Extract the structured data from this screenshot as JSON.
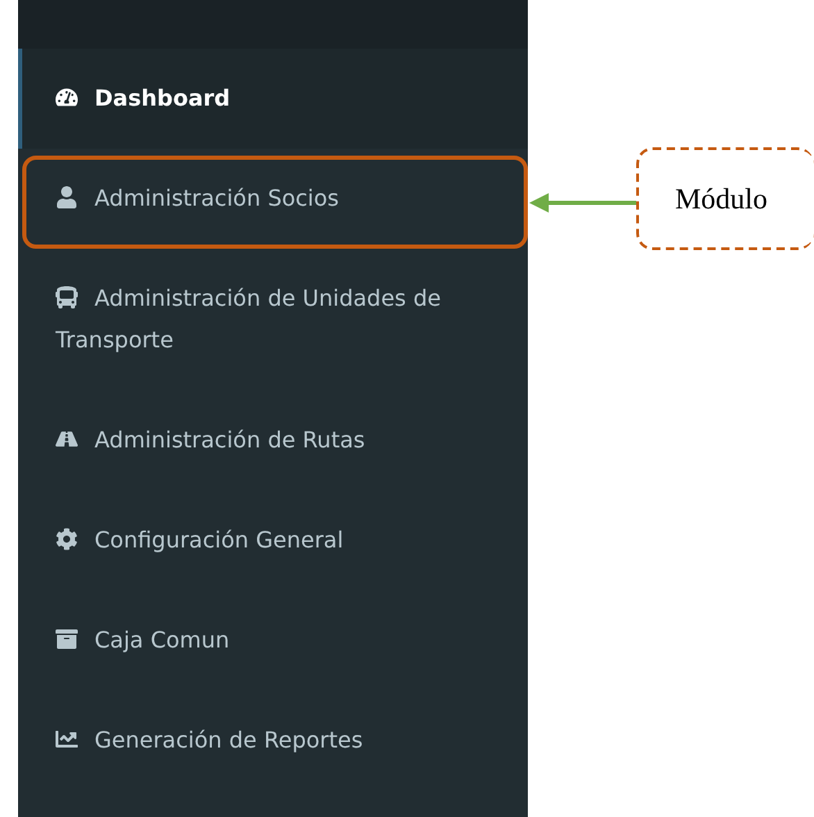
{
  "sidebar": {
    "items": [
      {
        "label": "Dashboard",
        "selected": true,
        "highlighted": false
      },
      {
        "label": "Administración Socios",
        "selected": false,
        "highlighted": true
      },
      {
        "label": "Administración de Unidades de Transporte",
        "selected": false,
        "highlighted": false
      },
      {
        "label": "Administración de Rutas",
        "selected": false,
        "highlighted": false
      },
      {
        "label": "Configuración General",
        "selected": false,
        "highlighted": false
      },
      {
        "label": "Caja Comun",
        "selected": false,
        "highlighted": false
      },
      {
        "label": "Generación de Reportes",
        "selected": false,
        "highlighted": false
      }
    ]
  },
  "annotation": {
    "label": "Módulo"
  }
}
